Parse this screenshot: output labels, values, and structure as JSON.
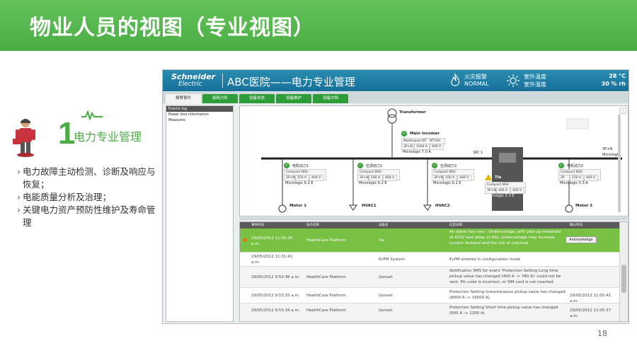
{
  "banner": {
    "title": "物业人员的视图（专业视图）"
  },
  "side": {
    "number": "1",
    "title": "电力专业管理",
    "bullets": [
      "电力故障主动检测、诊断及响应与恢复；",
      "电能质量分析及治理；",
      "关键电力资产预防性维护及寿命管理"
    ]
  },
  "page_number": "18",
  "app": {
    "logo_brand": "Schneider",
    "logo_sub": "Electric",
    "title": "ABC医院——电力专业管理",
    "fire_label": "火灾报警",
    "fire_value": "NORMAL",
    "temp_label": "室外温度",
    "humidity_label": "室外湿度",
    "temp_value": "28 °C",
    "humidity_value": "30 % rh",
    "tabs": [
      "报警事件",
      "能耗分析",
      "设备状态",
      "设备维护",
      "设备文档"
    ],
    "sidebar": [
      "Events log",
      "Power loss information",
      "Measures"
    ],
    "diagram": {
      "transformer": "Transformer",
      "main_incomer": "Main Incomer",
      "main_incomer_model": "Masterpact NT · NT16H",
      "main_incomer_vals": [
        "3P+N",
        "1600 A",
        "400 V"
      ],
      "main_incomer_trip": "Micrologic 7.0 A",
      "bus_label": "WC 1",
      "tie": "Tie",
      "tie_model": "Compact NSX · NSX400F",
      "tie_vals": [
        "3P+N",
        "400 A",
        "400 V"
      ],
      "tie_trip": "Micrologic 5.3 E",
      "feeders": [
        {
          "name": "电机动力1",
          "model": "Compact NSX · NSX250N",
          "vals": [
            "3P+N",
            "250 A",
            "400 V"
          ],
          "trip": "Micrologic 6.2 E",
          "load": "Motor 1"
        },
        {
          "name": "空调动力1",
          "model": "Compact NSX · NSX100N",
          "vals": [
            "3P+N",
            "100 A",
            "400 V"
          ],
          "trip": "Micrologic 6.2 E",
          "load": "HVAC1"
        },
        {
          "name": "空调动力2",
          "model": "Compact NSX · NSX100N",
          "vals": [
            "3P+N",
            "100 A",
            "400 V"
          ],
          "trip": "Micrologic 6.2 E",
          "load": "HVAC2"
        },
        {
          "name": "电机动力2",
          "model": "Compact NSX · NSX250N",
          "vals": [
            "3P",
            "250 A",
            "400 V"
          ],
          "trip": "Micrologic 5.3 A",
          "load": "Motor 2"
        }
      ],
      "right_vals": "3P+N",
      "right_trip": "Micrologi"
    },
    "events": {
      "headers": [
        "事件时间",
        "站点名称",
        "设备名",
        "信息详情",
        "确认时间"
      ],
      "ack_label": "Acknowledge",
      "rows": [
        {
          "time": "29/05/2012 11:30:26 a.m.",
          "site": "HealthCare Platform",
          "device": "Tie",
          "detail": "An alarm has rose : Undervoltage, with pick-up threshold at 432V and delay at 60s. Undervoltage may increase current demand and the risk of overload.",
          "ack": ""
        },
        {
          "time": "29/05/2012 11:31:41 a.m.",
          "site": "",
          "device": "EcPM System",
          "detail": "EcPM entered in configuration mode",
          "ack": ""
        },
        {
          "time": "29/05/2012 9:53:36 a.m.",
          "site": "HealthCare Platform",
          "device": "Genset",
          "detail": "Notification SMS for event 'Protection Setting Long time pickup value has changed (400 A -> 780 A)' could not be sent: Pin code is incorrect, or SIM card is not inserted.",
          "ack": ""
        },
        {
          "time": "29/05/2012 9:53:35 a.m.",
          "site": "HealthCare Platform",
          "device": "Genset",
          "detail": "Protection Setting Instantaneous pickup value has changed (8000 A -> 16000 A)",
          "ack": "29/05/2012 11:05:41 a.m."
        },
        {
          "time": "29/05/2012 9:53:34 a.m.",
          "site": "HealthCare Platform",
          "device": "Genset",
          "detail": "Protection Setting Short time pickup value has changed (600 A -> 1200 A)",
          "ack": "29/05/2012 11:05:37 a.m."
        }
      ]
    }
  }
}
